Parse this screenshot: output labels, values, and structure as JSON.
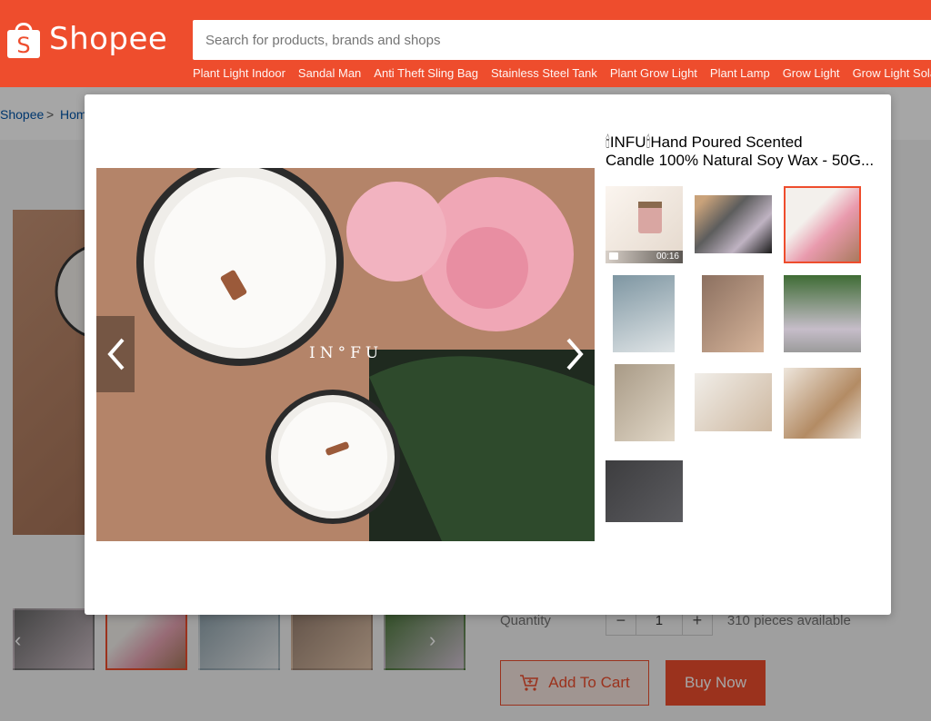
{
  "header": {
    "logo_text": "Shopee",
    "logo_letter": "S",
    "search_placeholder": "Search for products, brands and shops",
    "quick_links": [
      "Plant Light Indoor",
      "Sandal Man",
      "Anti Theft Sling Bag",
      "Stainless Steel Tank",
      "Plant Grow Light",
      "Plant Lamp",
      "Grow Light",
      "Grow Light Solar"
    ]
  },
  "breadcrumb": {
    "root": "Shopee",
    "separator": ">",
    "next": "Hom"
  },
  "purchase": {
    "quantity_label": "Quantity",
    "minus": "−",
    "plus": "+",
    "quantity_value": "1",
    "available": "310 pieces available",
    "add_to_cart": "Add To Cart",
    "buy_now": "Buy Now"
  },
  "modal": {
    "title_line1": "🕯INFU🕯Hand Poured Scented",
    "title_line2": "Candle 100% Natural Soy Wax - 50G...",
    "main_image_brand": "IN°FU",
    "video_duration": "00:16",
    "prev_icon": "chevron-left-icon",
    "next_icon": "chevron-right-icon"
  },
  "colors": {
    "brand": "#ee4d2d",
    "link": "#0055aa"
  }
}
